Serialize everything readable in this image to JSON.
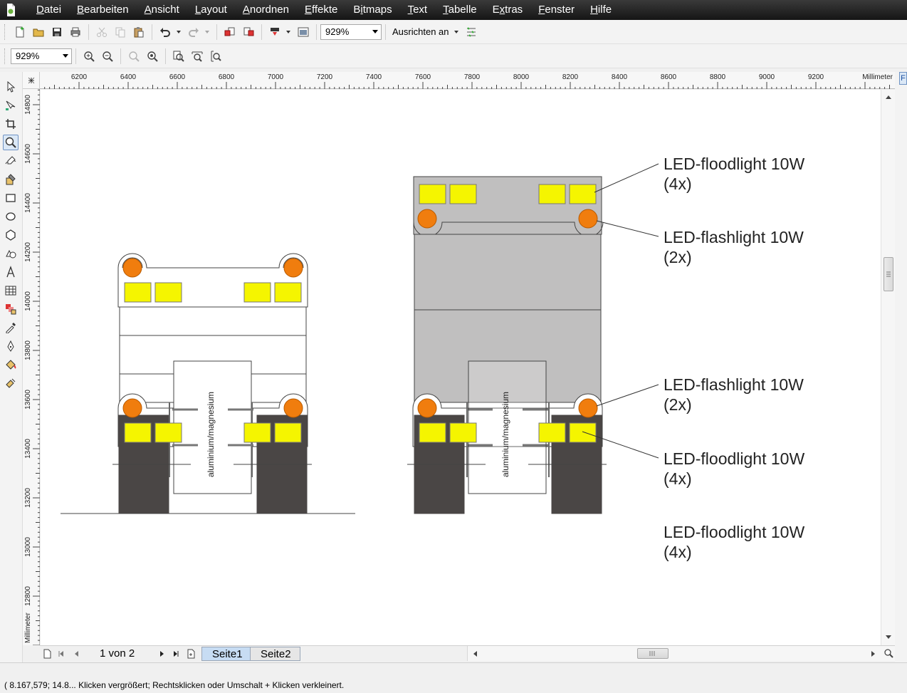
{
  "menubar": {
    "items": [
      {
        "pre": "",
        "ul": "D",
        "post": "atei"
      },
      {
        "pre": "",
        "ul": "B",
        "post": "earbeiten"
      },
      {
        "pre": "",
        "ul": "A",
        "post": "nsicht"
      },
      {
        "pre": "",
        "ul": "L",
        "post": "ayout"
      },
      {
        "pre": "",
        "ul": "A",
        "post": "nordnen"
      },
      {
        "pre": "",
        "ul": "E",
        "post": "ffekte"
      },
      {
        "pre": "B",
        "ul": "i",
        "post": "tmaps"
      },
      {
        "pre": "",
        "ul": "T",
        "post": "ext"
      },
      {
        "pre": "",
        "ul": "T",
        "post": "abelle"
      },
      {
        "pre": "E",
        "ul": "x",
        "post": "tras"
      },
      {
        "pre": "",
        "ul": "F",
        "post": "enster"
      },
      {
        "pre": "",
        "ul": "H",
        "post": "ilfe"
      }
    ]
  },
  "toolbar": {
    "zoom_value": "929%",
    "align_label": "Ausrichten an"
  },
  "zoombar": {
    "zoom_value": "929%"
  },
  "ruler": {
    "unit": "Millimeter",
    "h_ticks": [
      "6200",
      "6400",
      "6600",
      "6800",
      "7000",
      "7200",
      "7400",
      "7600",
      "7800",
      "8000",
      "8200",
      "8400",
      "8600",
      "8800",
      "9000",
      "9200"
    ],
    "v_ticks": [
      "14800",
      "14600",
      "14400",
      "14200",
      "14000",
      "13800",
      "13600",
      "13400",
      "13200",
      "13000",
      "12800"
    ]
  },
  "drawing": {
    "vertical_label": "aluminium/magnesium",
    "annotations": [
      {
        "line1": "LED-floodlight 10W",
        "line2": "(4x)"
      },
      {
        "line1": "LED-flashlight 10W",
        "line2": "(2x)"
      },
      {
        "line1": "LED-flashlight 10W",
        "line2": "(2x)"
      },
      {
        "line1": "LED-floodlight 10W",
        "line2": "(4x)"
      },
      {
        "line1": "LED-floodlight 10W",
        "line2": "(4x)"
      }
    ],
    "colors": {
      "lamp_orange": "#f07d0e",
      "flood_yellow": "#f5f500",
      "body_gray": "#c0bfbf",
      "wheel_dark": "#4a4645"
    }
  },
  "pagenav": {
    "page_count": "1 von 2",
    "tabs": [
      "Seite1",
      "Seite2"
    ]
  },
  "status": {
    "text": "( 8.167,579; 14.8... Klicken vergrößert; Rechtsklicken oder Umschalt + Klicken verkleinert."
  }
}
